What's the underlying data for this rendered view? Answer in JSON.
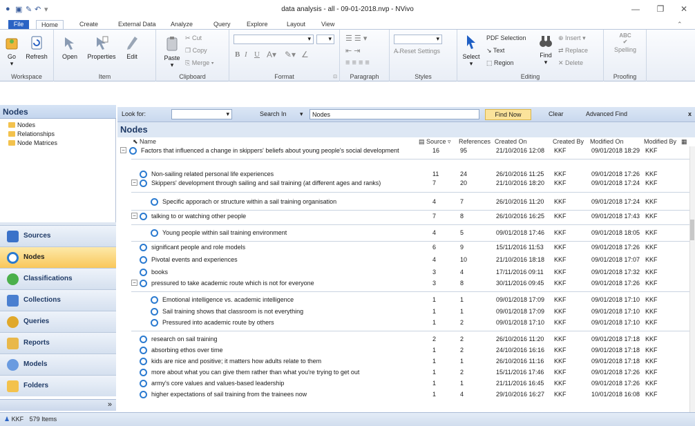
{
  "window": {
    "title": "data analysis - all - 09-01-2018.nvp - NVivo",
    "minimize": "—",
    "restore": "❐",
    "close": "✕"
  },
  "tabs": [
    "File",
    "Home",
    "Create",
    "External Data",
    "Analyze",
    "Query",
    "Explore",
    "Layout",
    "View"
  ],
  "ribbon": {
    "workspace": {
      "go": "Go",
      "refresh": "Refresh",
      "label": "Workspace"
    },
    "item": {
      "open": "Open",
      "properties": "Properties",
      "edit": "Edit",
      "label": "Item"
    },
    "clipboard": {
      "paste": "Paste",
      "cut": "Cut",
      "copy": "Copy",
      "merge": "Merge",
      "label": "Clipboard"
    },
    "format": {
      "label": "Format",
      "bold": "B",
      "italic": "I",
      "underline": "U"
    },
    "paragraph": {
      "label": "Paragraph"
    },
    "styles": {
      "reset": "Reset Settings",
      "label": "Styles"
    },
    "editing": {
      "select": "Select",
      "pdf_selection": "PDF Selection",
      "text": "Text",
      "region": "Region",
      "find": "Find",
      "insert": "Insert",
      "replace": "Replace",
      "delete": "Delete",
      "label": "Editing"
    },
    "proofing": {
      "spelling": "Spelling",
      "label": "Proofing",
      "abc": "ABC"
    }
  },
  "nav": {
    "header": "Nodes",
    "tree": [
      "Nodes",
      "Relationships",
      "Node Matrices"
    ],
    "buttons": [
      "Sources",
      "Nodes",
      "Classifications",
      "Collections",
      "Queries",
      "Reports",
      "Models",
      "Folders"
    ],
    "more": "»"
  },
  "findbar": {
    "look_for": "Look for:",
    "search_in": "Search In",
    "scope": "Nodes",
    "find_now": "Find Now",
    "clear": "Clear",
    "advanced": "Advanced Find",
    "close": "x"
  },
  "list": {
    "title": "Nodes",
    "columns": [
      "Name",
      "Source",
      "References",
      "Created On",
      "Created By",
      "Modified On",
      "Modified By"
    ],
    "rows": [
      {
        "name": "Factors that influenced a change in skippers' beliefs about young people's social development",
        "src": "16",
        "refs": "95",
        "created": "21/10/2016 12:08",
        "by": "KKF",
        "modified": "09/01/2018 18:29",
        "mby": "KKF"
      },
      {
        "name": "Non-sailing related personal life experiences",
        "src": "11",
        "refs": "24",
        "created": "26/10/2016 11:25",
        "by": "KKF",
        "modified": "09/01/2018 17:26",
        "mby": "KKF"
      },
      {
        "name": "Skippers' development through sailing and sail training (at different ages and ranks)",
        "src": "7",
        "refs": "20",
        "created": "21/10/2016 18:20",
        "by": "KKF",
        "modified": "09/01/2018 17:24",
        "mby": "KKF"
      },
      {
        "name": "Specific apporach or structure within a sail training organisation",
        "src": "4",
        "refs": "7",
        "created": "26/10/2016 11:20",
        "by": "KKF",
        "modified": "09/01/2018 17:24",
        "mby": "KKF"
      },
      {
        "name": "talking to or watching other people",
        "src": "7",
        "refs": "8",
        "created": "26/10/2016 16:25",
        "by": "KKF",
        "modified": "09/01/2018 17:43",
        "mby": "KKF"
      },
      {
        "name": "Young people within sail training environment",
        "src": "4",
        "refs": "5",
        "created": "09/01/2018 17:46",
        "by": "KKF",
        "modified": "09/01/2018 18:05",
        "mby": "KKF"
      },
      {
        "name": "significant people and role models",
        "src": "6",
        "refs": "9",
        "created": "15/11/2016 11:53",
        "by": "KKF",
        "modified": "09/01/2018 17:26",
        "mby": "KKF"
      },
      {
        "name": "Pivotal events and experiences",
        "src": "4",
        "refs": "10",
        "created": "21/10/2016 18:18",
        "by": "KKF",
        "modified": "09/01/2018 17:07",
        "mby": "KKF"
      },
      {
        "name": "books",
        "src": "3",
        "refs": "4",
        "created": "17/11/2016 09:11",
        "by": "KKF",
        "modified": "09/01/2018 17:32",
        "mby": "KKF"
      },
      {
        "name": "pressured to take academic route which is not for everyone",
        "src": "3",
        "refs": "8",
        "created": "30/11/2016 09:45",
        "by": "KKF",
        "modified": "09/01/2018 17:26",
        "mby": "KKF"
      },
      {
        "name": "Emotional intelligence vs. academic intelligence",
        "src": "1",
        "refs": "1",
        "created": "09/01/2018 17:09",
        "by": "KKF",
        "modified": "09/01/2018 17:10",
        "mby": "KKF"
      },
      {
        "name": "Sail training shows that classroom is not everything",
        "src": "1",
        "refs": "1",
        "created": "09/01/2018 17:09",
        "by": "KKF",
        "modified": "09/01/2018 17:10",
        "mby": "KKF"
      },
      {
        "name": "Pressured into academic route by others",
        "src": "1",
        "refs": "2",
        "created": "09/01/2018 17:10",
        "by": "KKF",
        "modified": "09/01/2018 17:10",
        "mby": "KKF"
      },
      {
        "name": "research on sail training",
        "src": "2",
        "refs": "2",
        "created": "26/10/2016 11:20",
        "by": "KKF",
        "modified": "09/01/2018 17:18",
        "mby": "KKF"
      },
      {
        "name": "absorbing ethos over time",
        "src": "1",
        "refs": "2",
        "created": "24/10/2016 16:16",
        "by": "KKF",
        "modified": "09/01/2018 17:18",
        "mby": "KKF"
      },
      {
        "name": "kids are nice and positive; it matters how adults relate to them",
        "src": "1",
        "refs": "1",
        "created": "26/10/2016 11:16",
        "by": "KKF",
        "modified": "09/01/2018 17:18",
        "mby": "KKF"
      },
      {
        "name": "more about what you can give them rather than what you're trying to get out",
        "src": "1",
        "refs": "2",
        "created": "15/11/2016 17:46",
        "by": "KKF",
        "modified": "09/01/2018 17:26",
        "mby": "KKF"
      },
      {
        "name": "army's core values and values-based leadership",
        "src": "1",
        "refs": "1",
        "created": "21/11/2016 16:45",
        "by": "KKF",
        "modified": "09/01/2018 17:26",
        "mby": "KKF"
      },
      {
        "name": "higher expectations of sail training from the trainees now",
        "src": "1",
        "refs": "4",
        "created": "29/10/2016 16:27",
        "by": "KKF",
        "modified": "10/01/2018 16:08",
        "mby": "KKF"
      }
    ]
  },
  "status": {
    "user": "KKF",
    "items": "579 Items"
  }
}
